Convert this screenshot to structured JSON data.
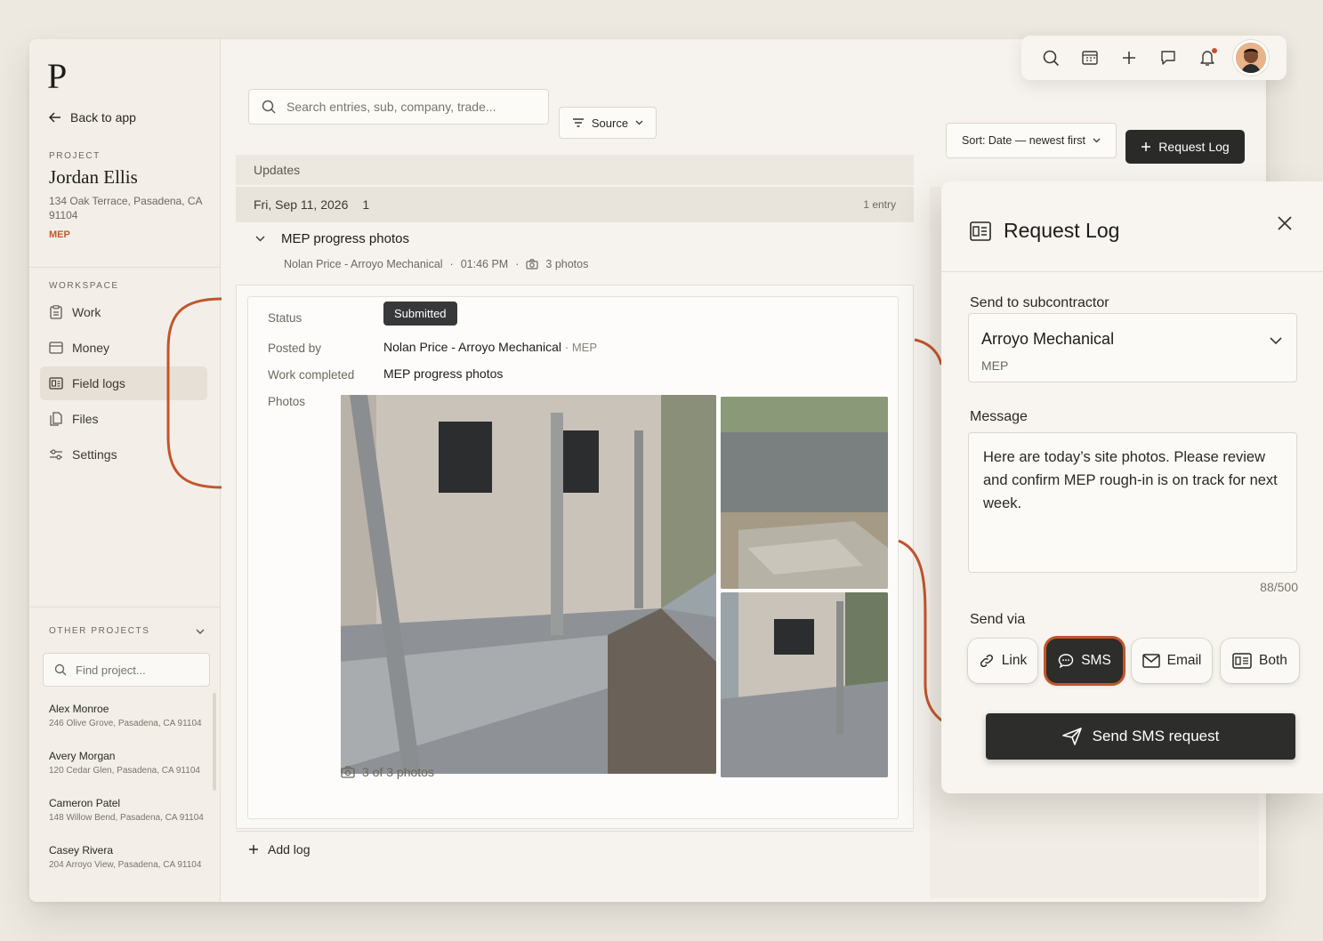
{
  "brand": {
    "logo_letter": "P",
    "accent_color": "#c4542b"
  },
  "sidebar": {
    "back_label": "Back to app",
    "project_label": "PROJECT",
    "project_name": "Jordan Ellis",
    "project_address": "134 Oak Terrace, Pasadena, CA 91104",
    "project_tag": "MEP",
    "workspace_label": "WORKSPACE",
    "nav": [
      {
        "label": "Work",
        "icon": "clipboard-icon"
      },
      {
        "label": "Money",
        "icon": "wallet-icon"
      },
      {
        "label": "Field logs",
        "icon": "field-log-icon",
        "active": true
      },
      {
        "label": "Files",
        "icon": "files-icon"
      },
      {
        "label": "Settings",
        "icon": "sliders-icon"
      }
    ],
    "other_projects_label": "OTHER PROJECTS",
    "find_placeholder": "Find project...",
    "other_projects": [
      {
        "name": "Alex Monroe",
        "address": "246 Olive Grove, Pasadena, CA 91104"
      },
      {
        "name": "Avery Morgan",
        "address": "120 Cedar Glen, Pasadena, CA 91104"
      },
      {
        "name": "Cameron Patel",
        "address": "148 Willow Bend, Pasadena, CA 91104"
      },
      {
        "name": "Casey Rivera",
        "address": "204 Arroyo View, Pasadena, CA 91104"
      }
    ]
  },
  "toolbar": {
    "search_placeholder": "Search entries, sub, company, trade...",
    "source_label": "Source",
    "sort_label": "Sort: Date — newest first",
    "request_label": "Request Log"
  },
  "feed": {
    "updates_label": "Updates",
    "date": "Fri, Sep 11, 2026",
    "date_count": "1",
    "entry_count": "1 entry",
    "entry": {
      "title": "MEP progress photos",
      "author": "Nolan Price - Arroyo Mechanical",
      "time": "01:46 PM",
      "photos": "3 photos",
      "status_label": "Status",
      "status_value": "Submitted",
      "posted_by_label": "Posted by",
      "posted_by_value": "Nolan Price - Arroyo Mechanical",
      "posted_by_trade": "MEP",
      "work_completed_label": "Work completed",
      "work_completed_value": "MEP progress photos",
      "photos_label": "Photos",
      "photo_count": "3 of 3 photos"
    },
    "add_log_label": "Add log"
  },
  "modal": {
    "title": "Request Log",
    "send_to_label": "Send to subcontractor",
    "subcontractor_name": "Arroyo Mechanical",
    "subcontractor_trade": "MEP",
    "message_label": "Message",
    "message_text": "Here are today’s site photos. Please review and confirm MEP rough-in is on track for next week.",
    "char_counter": "88/500",
    "send_via_label": "Send via",
    "via_options": [
      {
        "label": "Link",
        "icon": "link-icon"
      },
      {
        "label": "SMS",
        "icon": "chat-icon",
        "active": true
      },
      {
        "label": "Email",
        "icon": "mail-icon"
      },
      {
        "label": "Both",
        "icon": "both-icon"
      }
    ],
    "send_button": "Send SMS request"
  }
}
